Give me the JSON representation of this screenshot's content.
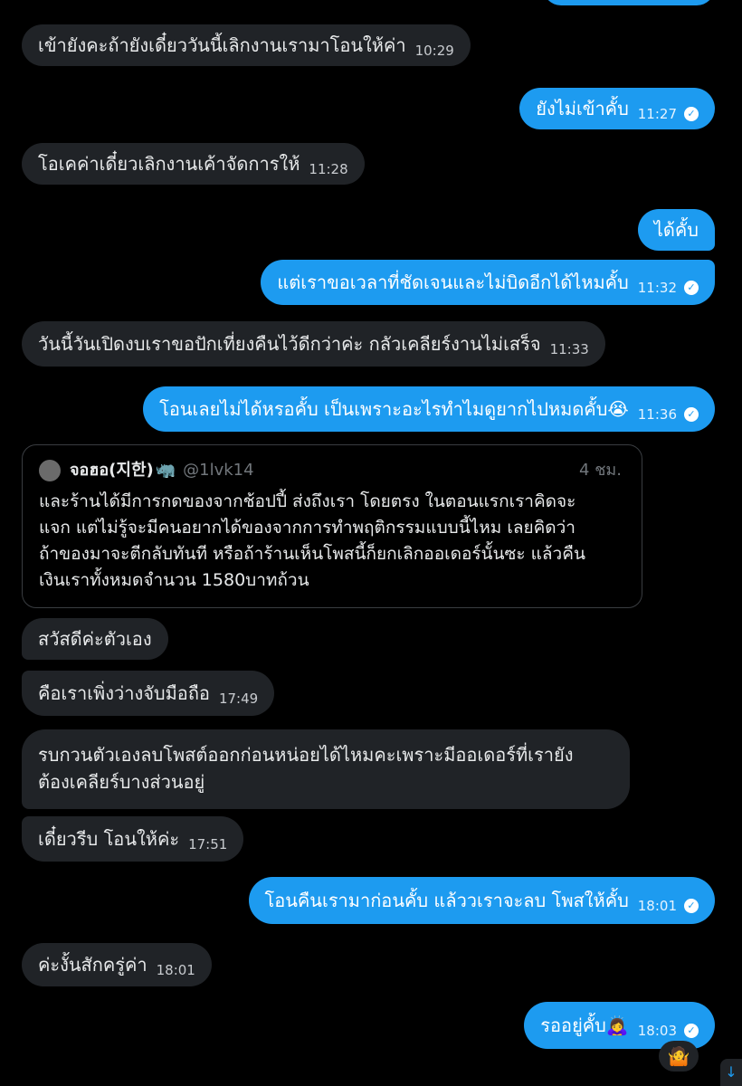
{
  "messages": [
    {
      "text": "เข้ายังคะถ้ายังเดี๋ยววันนี้เลิกงานเรามาโอนให้ค่า",
      "time": "10:29"
    },
    {
      "text": "ยังไม่เข้าคั้บ",
      "time": "11:27"
    },
    {
      "text": "โอเคค่าเดี๋ยวเลิกงานเค้าจัดการให้",
      "time": "11:28"
    },
    {
      "text": "ได้คั้บ",
      "time": ""
    },
    {
      "text": "แต่เราขอเวลาที่ชัดเจนและไม่บิดอีกได้ไหมคั้บ",
      "time": "11:32"
    },
    {
      "text": "วันนี้วันเปิดงบเราขอปักเที่ยงคืนไว้ดีกว่าค่ะ กลัวเคลียร์งานไม่เสร็จ",
      "time": "11:33"
    },
    {
      "text": "โอนเลยไม่ได้หรอคั้บ เป็นเพราะอะไรทำไมดูยากไปหมดคั้บ",
      "emoji": "😭",
      "time": "11:36"
    },
    {
      "text": "สวัสดีค่ะตัวเอง",
      "time": ""
    },
    {
      "text": "คือเราเพิ่งว่างจับมือถือ",
      "time": "17:49"
    },
    {
      "line1": "รบกวนตัวเองลบโพสต์ออกก่อนหน่อยได้ไหมคะเพราะมีออเดอร์ที่เรายัง",
      "line2": "ต้องเคลียร์บางส่วนอยู่",
      "time": ""
    },
    {
      "text": "เดี๋ยวรีบ โอนให้ค่ะ",
      "time": "17:51"
    },
    {
      "text": "โอนคืนเรามาก่อนคั้บ แล้ววเราจะลบ โพสให้คั้บ",
      "time": "18:01"
    },
    {
      "text": "ค่ะงั้นสักครู่ค่า",
      "time": "18:01"
    },
    {
      "text": "รออยู่คั้บ",
      "emoji": "🙇‍♀️",
      "time": "18:03"
    }
  ],
  "quoted": {
    "name": "จอฮอ(지한)",
    "name_emoji": "🦏",
    "handle": "@1lvk14",
    "ago": "4 ชม.",
    "lines": [
      "และร้านได้มีการกดของจากช้อปปี้ ส่งถึงเรา โดยตรง ในตอนแรกเราคิดจะ",
      "แจก แต่ไม่รู้จะมีคนอยากได้ของจากการทำพฤติกรรมแบบนี้ไหม  เลยคิดว่า",
      "ถ้าของมาจะตีกลับทันที หรือถ้าร้านเห็นโพสนี้ก็ยกเลิกออเดอร์นั้นซะ แล้วคืน",
      "เงินเราทั้งหมดจำนวน 1580บาทถ้วน"
    ]
  },
  "reaction_emoji": "🤷",
  "icons": {
    "check": "read-check-icon",
    "scroll": "scroll-down-icon"
  },
  "colors": {
    "background": "#000000",
    "incoming": "#202327",
    "outgoing": "#1d9bf0"
  }
}
